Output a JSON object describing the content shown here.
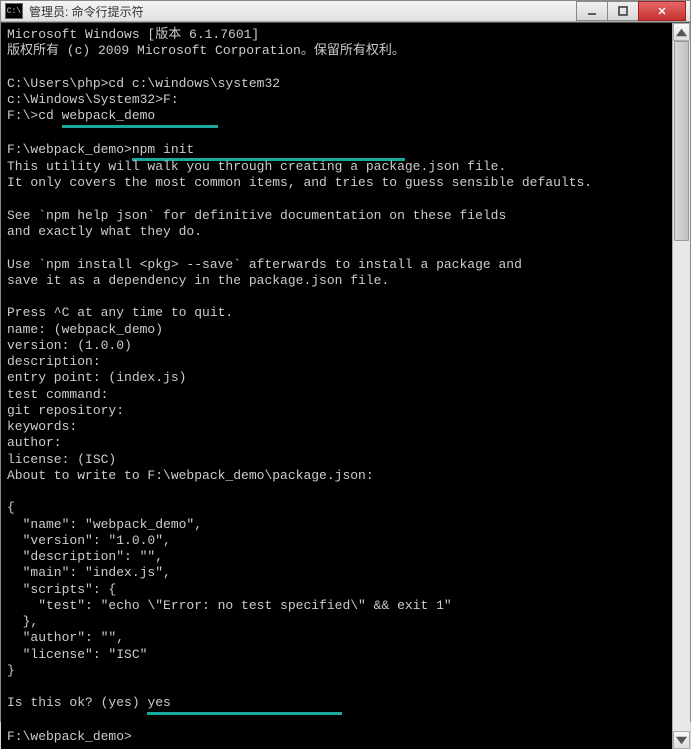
{
  "window": {
    "title": "管理员: 命令行提示符",
    "icon_label": "C:\\"
  },
  "terminal": {
    "line1": "Microsoft Windows [版本 6.1.7601]",
    "line2": "版权所有 (c) 2009 Microsoft Corporation。保留所有权利。",
    "blank1": "",
    "prompt1": "C:\\Users\\php>cd c:\\windows\\system32",
    "prompt2": "c:\\Windows\\System32>F:",
    "prompt3a": "F:\\>cd ",
    "hl1": "webpack_demo",
    "blank2": "",
    "prompt4a": "F:\\webpack_demo>",
    "hl2": "npm init",
    "util1": "This utility will walk you through creating a package.json file.",
    "util2": "It only covers the most common items, and tries to guess sensible defaults.",
    "blank3": "",
    "see1": "See `npm help json` for definitive documentation on these fields",
    "see2": "and exactly what they do.",
    "blank4": "",
    "use1": "Use `npm install <pkg> --save` afterwards to install a package and",
    "use2": "save it as a dependency in the package.json file.",
    "blank5": "",
    "press": "Press ^C at any time to quit.",
    "q_name": "name: (webpack_demo)",
    "q_version": "version: (1.0.0)",
    "q_desc": "description:",
    "q_entry": "entry point: (index.js)",
    "q_test": "test command:",
    "q_git": "git repository:",
    "q_keywords": "keywords:",
    "q_author": "author:",
    "q_license": "license: (ISC)",
    "about": "About to write to F:\\webpack_demo\\package.json:",
    "blank6": "",
    "json_open": "{",
    "json_name": "  \"name\": \"webpack_demo\",",
    "json_version": "  \"version\": \"1.0.0\",",
    "json_desc": "  \"description\": \"\",",
    "json_main": "  \"main\": \"index.js\",",
    "json_scripts": "  \"scripts\": {",
    "json_test": "    \"test\": \"echo \\\"Error: no test specified\\\" && exit 1\"",
    "json_scripts_close": "  },",
    "json_author": "  \"author\": \"\",",
    "json_license": "  \"license\": \"ISC\"",
    "json_close": "}",
    "blank7": "",
    "ok_a": "Is this ok? (yes) ",
    "hl3": "yes",
    "blank8": "",
    "final_prompt": "F:\\webpack_demo>"
  }
}
